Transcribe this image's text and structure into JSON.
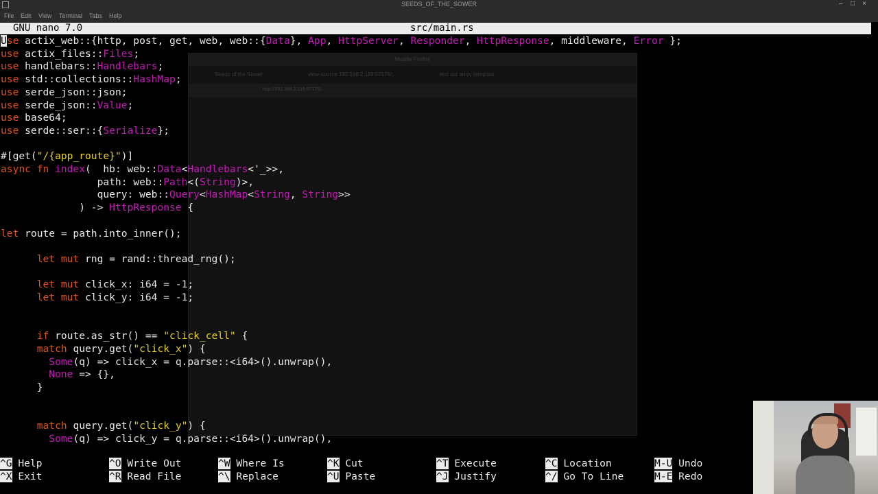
{
  "window": {
    "title": "SEEDS_OF_THE_SOWER",
    "controls": [
      "–",
      "□",
      "×"
    ]
  },
  "menubar": {
    "items": [
      "File",
      "Edit",
      "View",
      "Terminal",
      "Tabs",
      "Help"
    ]
  },
  "nano": {
    "version": "GNU nano 7.0",
    "filename": "src/main.rs"
  },
  "editor": {
    "lines": [
      [
        [
          "U",
          "cur"
        ],
        [
          "se",
          "k"
        ],
        [
          " actix_web::{http, post, get, web, web::{",
          ""
        ],
        [
          "Data",
          "t"
        ],
        [
          "}, ",
          ""
        ],
        [
          "App",
          "t"
        ],
        [
          ", ",
          ""
        ],
        [
          "HttpServer",
          "t"
        ],
        [
          ", ",
          ""
        ],
        [
          "Responder",
          "t"
        ],
        [
          ", ",
          ""
        ],
        [
          "HttpResponse",
          "t"
        ],
        [
          ", middleware, ",
          ""
        ],
        [
          "Error",
          "t"
        ],
        [
          " };",
          ""
        ]
      ],
      [
        [
          "use",
          "k"
        ],
        [
          " actix_files::",
          ""
        ],
        [
          "Files",
          "t"
        ],
        [
          ";",
          ""
        ]
      ],
      [
        [
          "use",
          "k"
        ],
        [
          " handlebars::",
          ""
        ],
        [
          "Handlebars",
          "t"
        ],
        [
          ";",
          ""
        ]
      ],
      [
        [
          "use",
          "k"
        ],
        [
          " std::collections::",
          ""
        ],
        [
          "HashMap",
          "t"
        ],
        [
          ";",
          ""
        ]
      ],
      [
        [
          "use",
          "k"
        ],
        [
          " serde_json::json;",
          ""
        ]
      ],
      [
        [
          "use",
          "k"
        ],
        [
          " serde_json::",
          ""
        ],
        [
          "Value",
          "t"
        ],
        [
          ";",
          ""
        ]
      ],
      [
        [
          "use",
          "k"
        ],
        [
          " base64;",
          ""
        ]
      ],
      [
        [
          "use",
          "k"
        ],
        [
          " serde::ser::{",
          ""
        ],
        [
          "Serialize",
          "t"
        ],
        [
          "};",
          ""
        ]
      ],
      [],
      [
        [
          "#[get(",
          ""
        ],
        [
          "\"/{app_route}\"",
          "s"
        ],
        [
          ")]",
          ""
        ]
      ],
      [
        [
          "async fn ",
          "k"
        ],
        [
          "index",
          "t"
        ],
        [
          "(  hb: web::",
          ""
        ],
        [
          "Data",
          "t"
        ],
        [
          "<",
          ""
        ],
        [
          "Handlebars",
          "t"
        ],
        [
          "<'_>>,",
          ""
        ]
      ],
      [
        [
          "                path: web::",
          ""
        ],
        [
          "Path",
          "t"
        ],
        [
          "<(",
          ""
        ],
        [
          "String",
          "t"
        ],
        [
          ")>,",
          ""
        ]
      ],
      [
        [
          "                query: web::",
          ""
        ],
        [
          "Query",
          "t"
        ],
        [
          "<",
          ""
        ],
        [
          "HashMap",
          "t"
        ],
        [
          "<",
          ""
        ],
        [
          "String",
          "t"
        ],
        [
          ", ",
          ""
        ],
        [
          "String",
          "t"
        ],
        [
          ">>",
          ""
        ]
      ],
      [
        [
          "             ) -> ",
          ""
        ],
        [
          "HttpResponse",
          "t"
        ],
        [
          " {",
          ""
        ]
      ],
      [],
      [
        [
          "let",
          "k"
        ],
        [
          " route = path.into_inner();",
          ""
        ]
      ],
      [],
      [
        [
          "      ",
          ""
        ],
        [
          "let mut",
          "k"
        ],
        [
          " rng = rand::thread_rng();",
          ""
        ]
      ],
      [],
      [
        [
          "      ",
          ""
        ],
        [
          "let mut",
          "k"
        ],
        [
          " click_x: i64 = -1;",
          ""
        ]
      ],
      [
        [
          "      ",
          ""
        ],
        [
          "let mut",
          "k"
        ],
        [
          " click_y: i64 = -1;",
          ""
        ]
      ],
      [],
      [],
      [
        [
          "      ",
          ""
        ],
        [
          "if",
          "k"
        ],
        [
          " route.as_str() == ",
          ""
        ],
        [
          "\"click_cell\"",
          "s"
        ],
        [
          " {",
          ""
        ]
      ],
      [
        [
          "      ",
          ""
        ],
        [
          "match",
          "k"
        ],
        [
          " query.get(",
          ""
        ],
        [
          "\"click_x\"",
          "s"
        ],
        [
          ") {",
          ""
        ]
      ],
      [
        [
          "        ",
          ""
        ],
        [
          "Some",
          "t"
        ],
        [
          "(q) => click_x = q.parse::<i64>().unwrap(),",
          ""
        ]
      ],
      [
        [
          "        ",
          ""
        ],
        [
          "None",
          "t"
        ],
        [
          " => {},",
          ""
        ]
      ],
      [
        [
          "      }",
          ""
        ]
      ],
      [],
      [],
      [
        [
          "      ",
          ""
        ],
        [
          "match",
          "k"
        ],
        [
          " query.get(",
          ""
        ],
        [
          "\"click_y\"",
          "s"
        ],
        [
          ") {",
          ""
        ]
      ],
      [
        [
          "        ",
          ""
        ],
        [
          "Some",
          "t"
        ],
        [
          "(q) => click_y = q.parse::<i64>().unwrap(),",
          ""
        ]
      ]
    ]
  },
  "ghost_window": {
    "title": "Mozilla Firefox",
    "tabs": [
      "Seeds of the Sower",
      "view-source:192.168.2.119:57175/...",
      "test out array template"
    ],
    "url": "http://192.168.2.119:57175/..."
  },
  "shortcuts": [
    {
      "key": "^G",
      "label": "Help"
    },
    {
      "key": "^X",
      "label": "Exit"
    },
    {
      "key": "^O",
      "label": "Write Out"
    },
    {
      "key": "^R",
      "label": "Read File"
    },
    {
      "key": "^W",
      "label": "Where Is"
    },
    {
      "key": "^\\",
      "label": "Replace"
    },
    {
      "key": "^K",
      "label": "Cut"
    },
    {
      "key": "^U",
      "label": "Paste"
    },
    {
      "key": "^T",
      "label": "Execute"
    },
    {
      "key": "^J",
      "label": "Justify"
    },
    {
      "key": "^C",
      "label": "Location"
    },
    {
      "key": "^/",
      "label": "Go To Line"
    },
    {
      "key": "M-U",
      "label": "Undo"
    },
    {
      "key": "M-E",
      "label": "Redo"
    }
  ],
  "colors": {
    "keyword": "#e0531d",
    "type": "#c21bb5",
    "string": "#e8d21d",
    "text": "#e8e8e8",
    "bar": "#ececec"
  }
}
